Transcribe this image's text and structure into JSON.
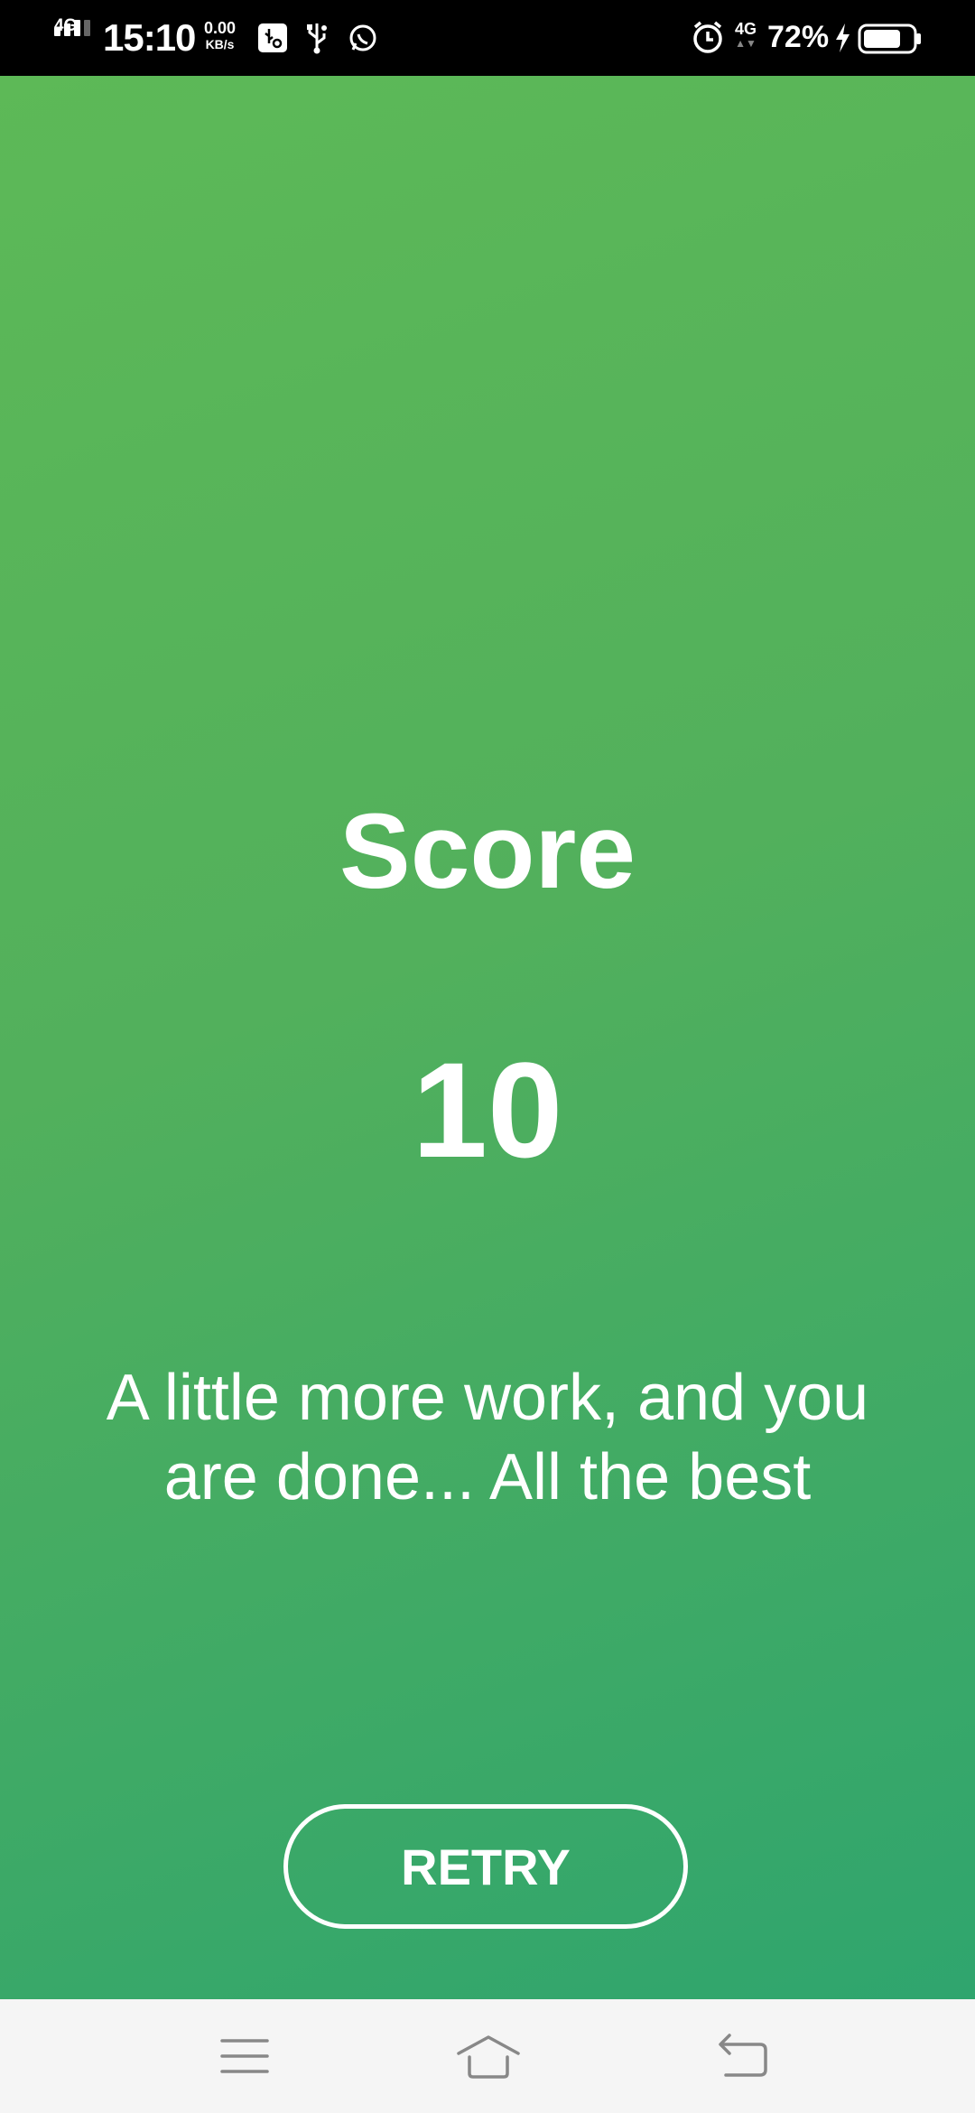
{
  "status_bar": {
    "network_left": "4G",
    "time": "15:10",
    "speed_value": "0.00",
    "speed_unit": "KB/s",
    "network_right": "4G",
    "battery_percent": "72%",
    "icons": [
      "signal-icon",
      "usb-settings-icon",
      "usb-icon",
      "whatsapp-icon",
      "alarm-icon",
      "charging-icon",
      "battery-icon"
    ]
  },
  "result": {
    "title": "Score",
    "score": "10",
    "message": "A little more work, and you are done... All the best",
    "retry_label": "RETRY"
  },
  "nav_bar": {
    "icons": [
      "menu-icon",
      "home-icon",
      "back-icon"
    ]
  },
  "colors": {
    "gradient_start": "#5db957",
    "gradient_end": "#2fa56e",
    "text": "#ffffff",
    "status_bar": "#000000",
    "nav_bar": "#f5f5f5"
  }
}
